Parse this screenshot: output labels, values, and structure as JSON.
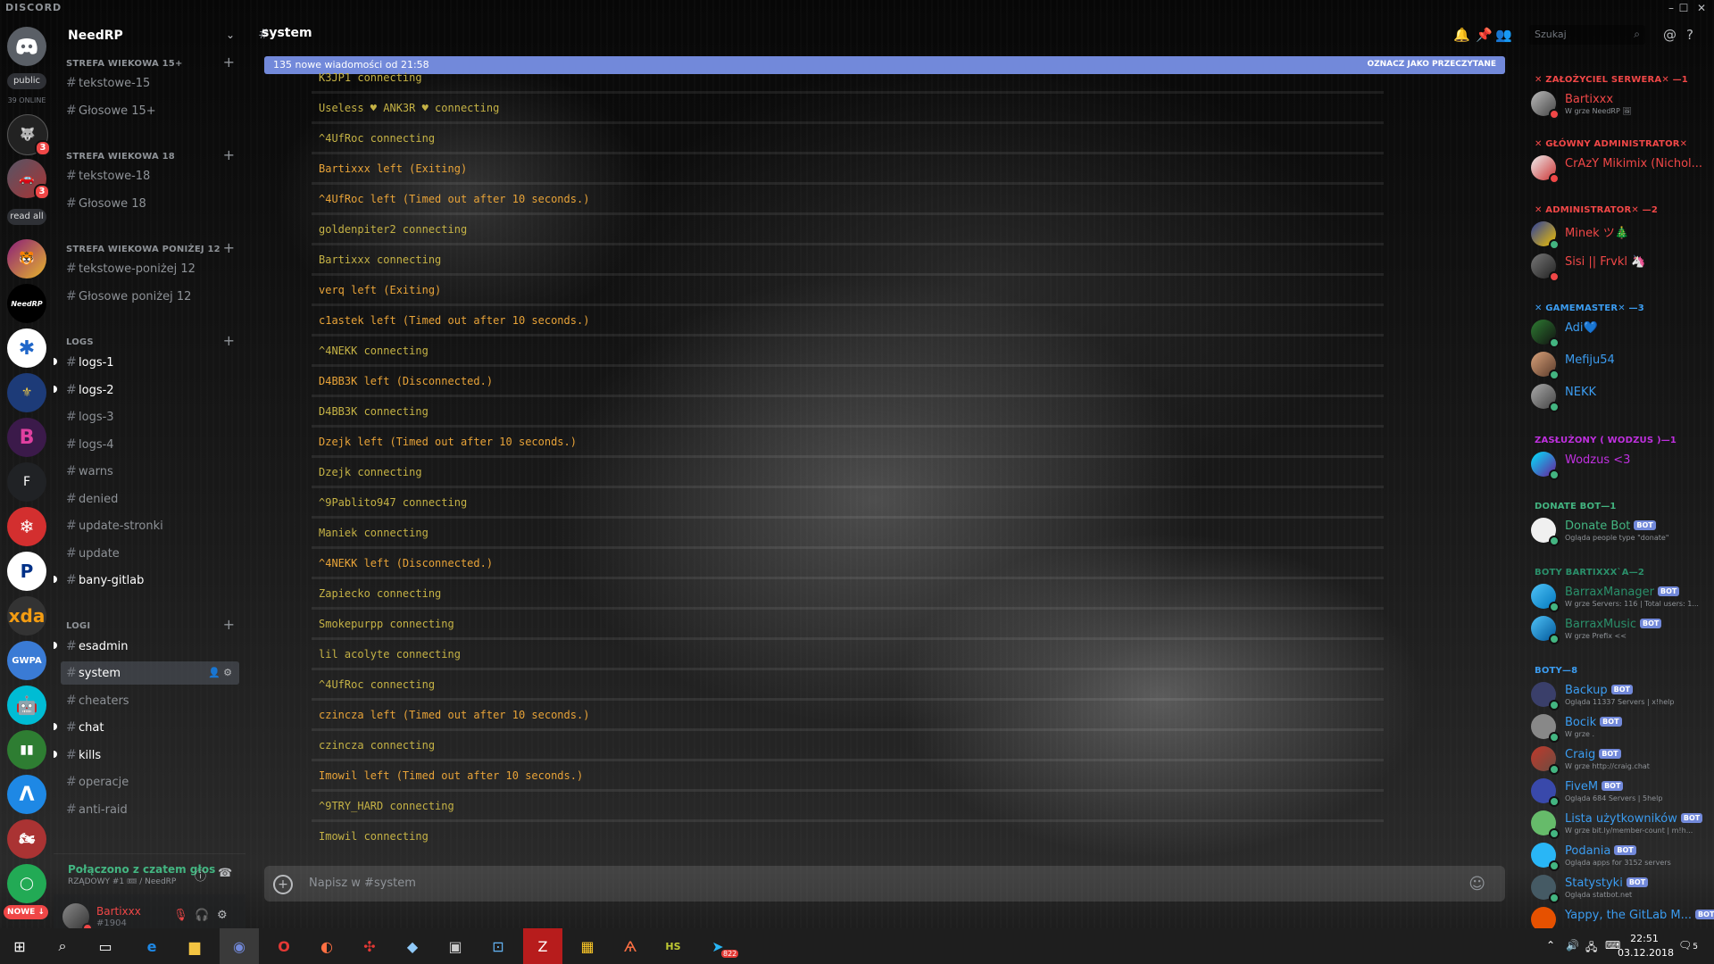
{
  "app": {
    "brand": "DISCORD"
  },
  "window": {
    "minimize": "–",
    "maximize": "☐",
    "close": "✕"
  },
  "rail": {
    "public_label": "public",
    "online_label": "39 ONLINE",
    "read_all_label": "read all",
    "badges": [
      "3",
      "3"
    ],
    "letter_server": "F",
    "new_label": "NOWE ↓"
  },
  "sidebar": {
    "guild_name": "NeedRP",
    "categories": [
      {
        "name": "STREFA WIEKOWA 15+"
      },
      {
        "name": "STREFA WIEKOWA 18"
      },
      {
        "name": "STREFA WIEKOWA PONIŻEJ 12"
      },
      {
        "name": "LOGS"
      },
      {
        "name": "LOGI"
      }
    ],
    "channels": [
      {
        "name": "tekstowe-15"
      },
      {
        "name": "Głosowe 15+"
      },
      {
        "name": "tekstowe-18"
      },
      {
        "name": "Głosowe 18"
      },
      {
        "name": "tekstowe-poniżej 12"
      },
      {
        "name": "Głosowe poniżej 12"
      },
      {
        "name": "logs-1"
      },
      {
        "name": "logs-2"
      },
      {
        "name": "logs-3"
      },
      {
        "name": "logs-4"
      },
      {
        "name": "warns"
      },
      {
        "name": "denied"
      },
      {
        "name": "update-stronki"
      },
      {
        "name": "update"
      },
      {
        "name": "bany-gitlab"
      },
      {
        "name": "esadmin"
      },
      {
        "name": "system"
      },
      {
        "name": "cheaters"
      },
      {
        "name": "chat"
      },
      {
        "name": "kills"
      },
      {
        "name": "operacje"
      },
      {
        "name": "anti-raid"
      }
    ]
  },
  "voice": {
    "title": "Połączono z czatem głos",
    "subtitle": "RZĄDOWY #1 🎟 / NeedRP"
  },
  "user": {
    "name": "Bartixxx",
    "tag": "#1904"
  },
  "header": {
    "channel": "system",
    "search_placeholder": "Szukaj"
  },
  "new_messages": {
    "text": "135 nowe wiadomości od 21:58",
    "action": "OZNACZ JAKO PRZECZYTANE"
  },
  "messages": [
    "K3JP1 connecting",
    "Useless ♥ ANK3R ♥ connecting",
    "^4UfRoc connecting",
    "Bartixxx left (Exiting)",
    "^4UfRoc left (Timed out after 10 seconds.)",
    "goldenpiter2 connecting",
    "Bartixxx connecting",
    "verq left (Exiting)",
    "c1astek left (Timed out after 10 seconds.)",
    "^4NEKK connecting",
    "D4BB3K left (Disconnected.)",
    "D4BB3K connecting",
    "Dzejk left (Timed out after 10 seconds.)",
    "Dzejk connecting",
    "^9Pablito947 connecting",
    "Maniek connecting",
    "^4NEKK left (Disconnected.)",
    "Zapiecko connecting",
    "Smokepurpp connecting",
    "lil acolyte connecting",
    "^4UfRoc connecting",
    "czincza left (Timed out after 10 seconds.)",
    "czincza connecting",
    "Imowil left (Timed out after 10 seconds.)",
    "^9TRY_HARD connecting",
    "Imowil connecting"
  ],
  "input": {
    "placeholder": "Napisz w #system"
  },
  "members": {
    "bot_tag": "BOT",
    "categories": [
      {
        "name": "✕ ZAŁOŻYCIEL SERWERA✕ —1",
        "color": "#f04747"
      },
      {
        "name": "✕ GŁÓWNY ADMINISTRATOR✕",
        "color": "#f04747"
      },
      {
        "name": "✕ ADMINISTRATOR✕ —2",
        "color": "#f04747"
      },
      {
        "name": "✕ GAMEMASTER✕ —3",
        "color": "#3b9cf0"
      },
      {
        "name": "ZASŁUŻONY ( WODZUS )—1",
        "color": "#c030e0"
      },
      {
        "name": "DONATE BOT—1",
        "color": "#43b581"
      },
      {
        "name": "BOTY BARTIXXX`A—2",
        "color": "#2a8f6a"
      },
      {
        "name": "BOTY—8",
        "color": "#3b9cf0"
      }
    ],
    "list": [
      {
        "name": "Bartixxx",
        "sub": "W grze NeedRP 🖼",
        "color": "#f04747"
      },
      {
        "name": "CrAzY Mikimix (Nichol...",
        "sub": "",
        "color": "#f04747"
      },
      {
        "name": "Minek ツ🎄",
        "sub": "",
        "color": "#f04747"
      },
      {
        "name": "Sisi || Frvkl 🦄",
        "sub": "",
        "color": "#f04747"
      },
      {
        "name": "Adi💙",
        "sub": "",
        "color": "#3b9cf0"
      },
      {
        "name": "Mefiju54",
        "sub": "",
        "color": "#3b9cf0"
      },
      {
        "name": "NEKK",
        "sub": "",
        "color": "#3b9cf0"
      },
      {
        "name": "Wodzus <3",
        "sub": "",
        "color": "#c030e0"
      },
      {
        "name": "Donate Bot",
        "sub": "Ogląda people type \"donate\"",
        "color": "#43b581",
        "bot": true
      },
      {
        "name": "BarraxManager",
        "sub": "W grze Servers: 116 | Total users: 1...",
        "color": "#2a8f6a",
        "bot": true
      },
      {
        "name": "BarraxMusic",
        "sub": "W grze Prefix <<",
        "color": "#2a8f6a",
        "bot": true
      },
      {
        "name": "Backup",
        "sub": "Ogląda 11337 Servers | x!help",
        "color": "#3b9cf0",
        "bot": true
      },
      {
        "name": "Bocik",
        "sub": "W grze .",
        "color": "#3b9cf0",
        "bot": true
      },
      {
        "name": "Craig",
        "sub": "W grze http://craig.chat",
        "color": "#3b9cf0",
        "bot": true
      },
      {
        "name": "FiveM",
        "sub": "Ogląda 684 Servers | 5help",
        "color": "#3b9cf0",
        "bot": true
      },
      {
        "name": "Lista użytkowników",
        "sub": "W grze bit.ly/member-count | m!h...",
        "color": "#3b9cf0",
        "bot": true
      },
      {
        "name": "Podania",
        "sub": "Ogląda apps for 3152 servers",
        "color": "#3b9cf0",
        "bot": true
      },
      {
        "name": "Statystyki",
        "sub": "Ogląda statbot.net",
        "color": "#3b9cf0",
        "bot": true
      },
      {
        "name": "Yappy, the GitLab M...",
        "sub": "",
        "color": "#3b9cf0",
        "bot": true
      }
    ]
  },
  "taskbar": {
    "time": "22:51",
    "date": "03.12.2018",
    "notif_count": "5",
    "telegram_count": "822"
  }
}
